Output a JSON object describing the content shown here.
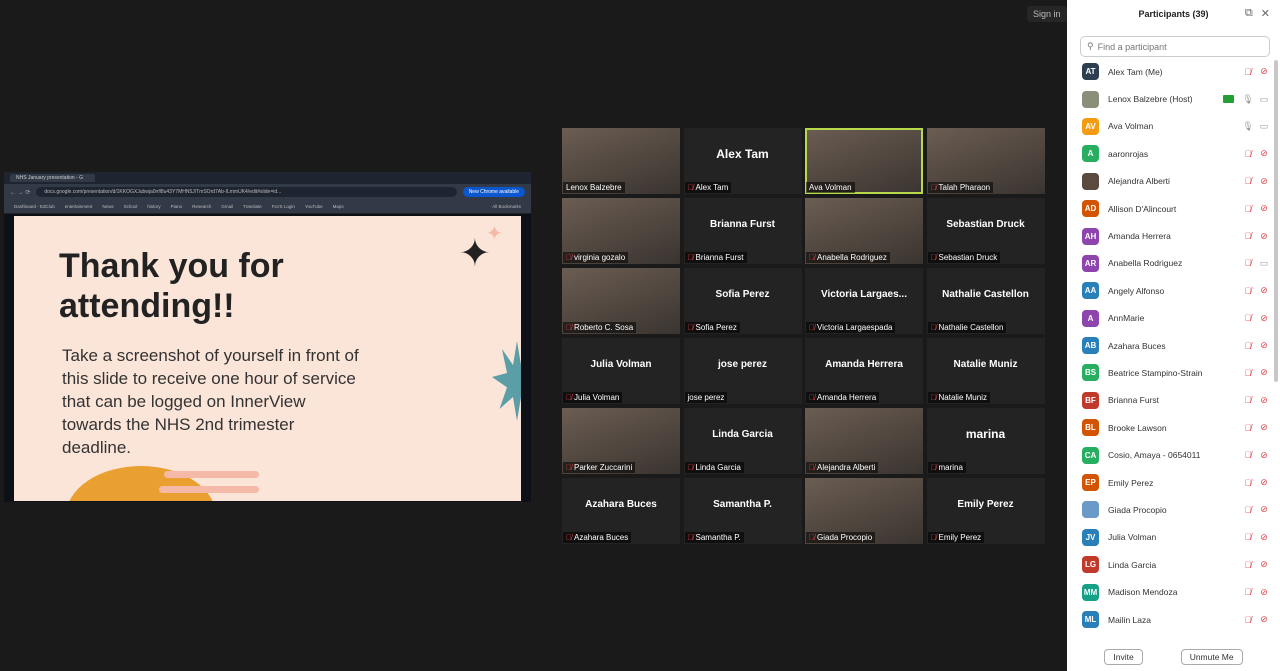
{
  "top": {
    "signin": "Sign in"
  },
  "browser": {
    "tab": "NHS January presentation - G",
    "url": "docs.google.com/presentation/d/1KKOGXJubwja0nfl8u43Y7MHN5J/TmSOrd7Ab-ILmmUK4/edit#slide=id...",
    "chrome_btn": "New Chrome available",
    "bookmarks": [
      "Dashboard - EdClub",
      "entertainment",
      "News",
      "School",
      "history",
      "Piano",
      "Research",
      "Gmail",
      "Translate",
      "FLVS Login",
      "YouTube",
      "Maps",
      "All Bookmarks"
    ]
  },
  "slide": {
    "title": "Thank you for attending!!",
    "body": "Take a screenshot of yourself in front of this slide to receive one hour of service that can be logged on InnerView towards the NHS 2nd trimester deadline."
  },
  "grid": [
    {
      "big": "",
      "label": "Lenox Balzebre",
      "video": true,
      "muted": false
    },
    {
      "big": "Alex Tam",
      "label": "Alex Tam",
      "video": false,
      "muted": true
    },
    {
      "big": "",
      "label": "Ava Volman",
      "video": true,
      "muted": false,
      "active": true
    },
    {
      "big": "",
      "label": "Talah Pharaon",
      "video": true,
      "muted": true
    },
    {
      "big": "",
      "label": "virginia gozalo",
      "video": true,
      "muted": true
    },
    {
      "big": "Brianna Furst",
      "label": "Brianna Furst",
      "video": false,
      "muted": true
    },
    {
      "big": "",
      "label": "Anabella Rodriguez",
      "video": true,
      "muted": true
    },
    {
      "big": "Sebastian Druck",
      "label": "Sebastian Druck",
      "video": false,
      "muted": true
    },
    {
      "big": "",
      "label": "Roberto C. Sosa",
      "video": true,
      "muted": true
    },
    {
      "big": "Sofia Perez",
      "label": "Sofia Perez",
      "video": false,
      "muted": true
    },
    {
      "big": "Victoria  Largaes...",
      "label": "Victoria Largaespada",
      "video": false,
      "muted": true
    },
    {
      "big": "Nathalie Castellon",
      "label": "Nathalie Castellon",
      "video": false,
      "muted": true
    },
    {
      "big": "Julia Volman",
      "label": "Julia Volman",
      "video": false,
      "muted": true
    },
    {
      "big": "jose perez",
      "label": "jose perez",
      "video": false,
      "muted": false
    },
    {
      "big": "Amanda Herrera",
      "label": "Amanda Herrera",
      "video": false,
      "muted": true
    },
    {
      "big": "Natalie Muniz",
      "label": "Natalie Muniz",
      "video": false,
      "muted": true
    },
    {
      "big": "",
      "label": "Parker Zuccarini",
      "video": true,
      "muted": true
    },
    {
      "big": "Linda Garcia",
      "label": "Linda Garcia",
      "video": false,
      "muted": true
    },
    {
      "big": "",
      "label": "Alejandra Alberti",
      "video": true,
      "muted": true
    },
    {
      "big": "marina",
      "label": "marina",
      "video": false,
      "muted": true
    },
    {
      "big": "Azahara Buces",
      "label": "Azahara Buces",
      "video": false,
      "muted": true
    },
    {
      "big": "Samantha P.",
      "label": "Samantha P.",
      "video": false,
      "muted": true
    },
    {
      "big": "",
      "label": "Giada Procopio",
      "video": true,
      "muted": true
    },
    {
      "big": "Emily Perez",
      "label": "Emily Perez",
      "video": false,
      "muted": true
    }
  ],
  "panel": {
    "title": "Participants (39)",
    "search_placeholder": "Find a participant",
    "invite": "Invite",
    "unmute": "Unmute Me",
    "participants": [
      {
        "initials": "AT",
        "name": "Alex Tam (Me)",
        "color": "#2d3e50",
        "mic": "off",
        "cam": "off"
      },
      {
        "initials": "",
        "name": "Lenox Balzebre (Host)",
        "color": "#8a8f7a",
        "mic": "on",
        "cam": "on",
        "sharing": true
      },
      {
        "initials": "AV",
        "name": "Ava Volman",
        "color": "#f39c12",
        "mic": "on",
        "cam": "on"
      },
      {
        "initials": "A",
        "name": "aaronrojas",
        "color": "#27ae60",
        "mic": "off",
        "cam": "off"
      },
      {
        "initials": "",
        "name": "Alejandra Alberti",
        "color": "#5a4a40",
        "mic": "off",
        "cam": "off"
      },
      {
        "initials": "AD",
        "name": "Allison D'Alincourt",
        "color": "#d35400",
        "mic": "off",
        "cam": "off"
      },
      {
        "initials": "AH",
        "name": "Amanda Herrera",
        "color": "#8e44ad",
        "mic": "off",
        "cam": "off"
      },
      {
        "initials": "AR",
        "name": "Anabella Rodriguez",
        "color": "#8e44ad",
        "mic": "off",
        "cam": "on"
      },
      {
        "initials": "AA",
        "name": "Angely Alfonso",
        "color": "#2980b9",
        "mic": "off",
        "cam": "off"
      },
      {
        "initials": "A",
        "name": "AnnMarie",
        "color": "#8e44ad",
        "mic": "off",
        "cam": "off"
      },
      {
        "initials": "AB",
        "name": "Azahara Buces",
        "color": "#2980b9",
        "mic": "off",
        "cam": "off"
      },
      {
        "initials": "BS",
        "name": "Beatrice Stampino-Strain",
        "color": "#27ae60",
        "mic": "off",
        "cam": "off"
      },
      {
        "initials": "BF",
        "name": "Brianna Furst",
        "color": "#c0392b",
        "mic": "off",
        "cam": "off"
      },
      {
        "initials": "BL",
        "name": "Brooke Lawson",
        "color": "#d35400",
        "mic": "off",
        "cam": "off"
      },
      {
        "initials": "CA",
        "name": "Cosio, Amaya - 0654011",
        "color": "#27ae60",
        "mic": "off",
        "cam": "off"
      },
      {
        "initials": "EP",
        "name": "Emily Perez",
        "color": "#d35400",
        "mic": "off",
        "cam": "off"
      },
      {
        "initials": "",
        "name": "Giada Procopio",
        "color": "#6a9ac8",
        "mic": "off",
        "cam": "off"
      },
      {
        "initials": "JV",
        "name": "Julia Volman",
        "color": "#2980b9",
        "mic": "off",
        "cam": "off"
      },
      {
        "initials": "LG",
        "name": "Linda Garcia",
        "color": "#c0392b",
        "mic": "off",
        "cam": "off"
      },
      {
        "initials": "MM",
        "name": "Madison Mendoza",
        "color": "#16a085",
        "mic": "off",
        "cam": "off"
      },
      {
        "initials": "ML",
        "name": "Mailin Laza",
        "color": "#2980b9",
        "mic": "off",
        "cam": "off"
      }
    ]
  }
}
